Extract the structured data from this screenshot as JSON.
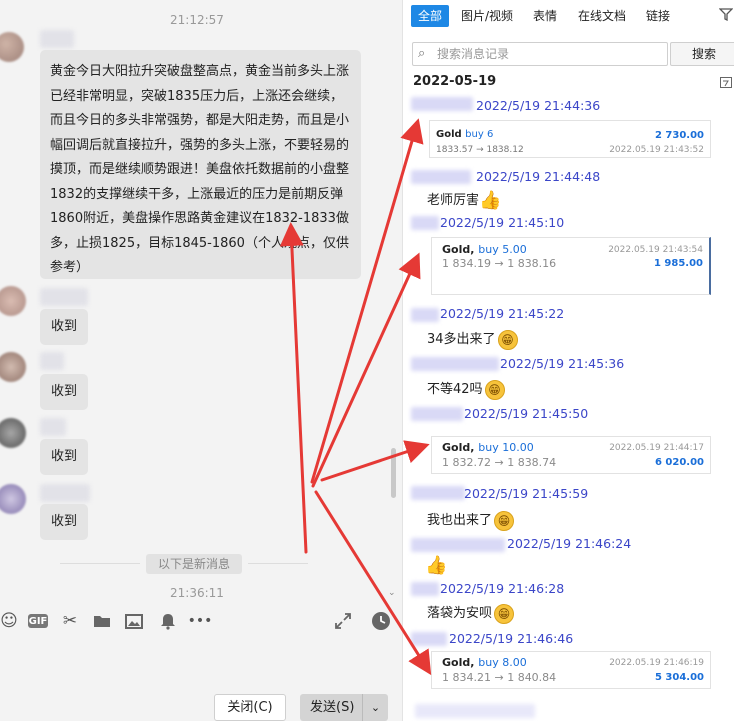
{
  "left": {
    "time_top": "21:12:57",
    "big_message": "黄金今日大阳拉升突破盘整高点，黄金当前多头上涨已经非常明显，突破1835压力后，上涨还会继续，而且今日的多头非常强势，都是大阳走势，而且是小幅回调后就直接拉升，强势的多头上涨，不要轻易的摸顶，而是继续顺势跟进！美盘依托数据前的小盘整1832的支撑继续干多，上涨最近的压力是前期反弹1860附近，美盘操作思路黄金建议在1832-1833做多，止损1825，目标1845-1860（个人观点，仅供参考）",
    "replies": [
      "收到",
      "收到",
      "收到",
      "收到"
    ],
    "new_messages_label": "以下是新消息",
    "time_bottom": "21:36:11",
    "close_label": "关闭(C)",
    "send_label": "发送(S)",
    "toolbar_icons": [
      "smile-icon",
      "gif-icon",
      "scissors-icon",
      "folder-icon",
      "image-icon",
      "bell-icon",
      "more-icon",
      "expand-icon",
      "history-icon"
    ]
  },
  "right": {
    "tabs": [
      "全部",
      "图片/视频",
      "表情",
      "在线文档",
      "链接"
    ],
    "search_placeholder": "搜索消息记录",
    "search_button": "搜索",
    "date_header": "2022-05-19",
    "entries": [
      {
        "time": "2022/5/19 21:44:36"
      },
      {
        "time": "2022/5/19 21:44:48",
        "text": "老师厉害"
      },
      {
        "time": "2022/5/19 21:45:10"
      },
      {
        "time": "2022/5/19 21:45:22",
        "text": "34多出来了"
      },
      {
        "time": "2022/5/19 21:45:36",
        "text": "不等42吗"
      },
      {
        "time": "2022/5/19 21:45:50"
      },
      {
        "time": "2022/5/19 21:45:59",
        "text": "我也出来了"
      },
      {
        "time": "2022/5/19 21:46:24"
      },
      {
        "time": "2022/5/19 21:46:28",
        "text": "落袋为安呗"
      },
      {
        "time": "2022/5/19 21:46:46"
      }
    ],
    "cards": [
      {
        "symbol": "Gold",
        "side": "buy 6",
        "prices": "1833.57 → 1838.12",
        "amount": "2 730.00",
        "datetime": "2022.05.19 21:43:52"
      },
      {
        "symbol": "Gold,",
        "side": "buy 5.00",
        "prices": "1 834.19 → 1 838.16",
        "amount": "1 985.00",
        "datetime": "2022.05.19 21:43:54"
      },
      {
        "symbol": "Gold,",
        "side": "buy 10.00",
        "prices": "1 832.72 → 1 838.74",
        "amount": "6 020.00",
        "datetime": "2022.05.19 21:44:17"
      },
      {
        "symbol": "Gold,",
        "side": "buy 8.00",
        "prices": "1 834.21 → 1 840.84",
        "amount": "5 304.00",
        "datetime": "2022.05.19 21:46:19"
      }
    ],
    "thumb_emoji": "👍",
    "grin_emoji": "😁"
  },
  "colors": {
    "accent": "#1e88e5",
    "time_blue": "#3b46c8",
    "arrow_red": "#e53935",
    "amount_blue": "#1a6ed8"
  }
}
